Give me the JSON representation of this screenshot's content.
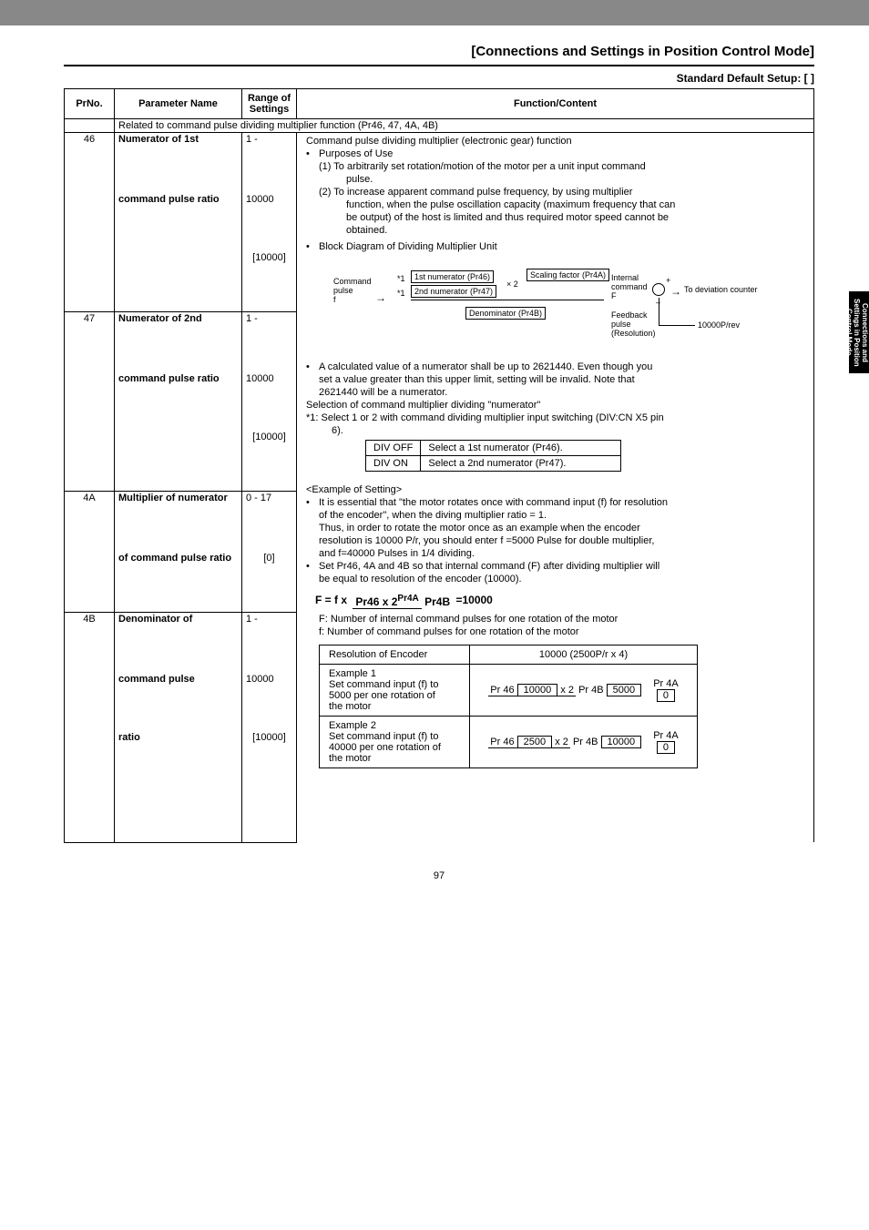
{
  "header": {
    "title": "[Connections and Settings in Position Control Mode]",
    "default_setup": "Standard Default Setup: [    ]"
  },
  "side_tab": "Connections and Settings in Position Control Mode",
  "page_number": "97",
  "columns": {
    "prno": "PrNo.",
    "name": "Parameter Name",
    "range": "Range of Settings",
    "func": "Function/Content"
  },
  "related_row": "Related to command pulse dividing multiplier function (Pr46, 47, 4A, 4B)",
  "rows": [
    {
      "prno": "46",
      "name_l1": "Numerator of 1st",
      "name_l2": "command pulse ratio",
      "range_l1": "1 -",
      "range_l2": "10000",
      "range_l3": "[10000]"
    },
    {
      "prno": "47",
      "name_l1": "Numerator of 2nd",
      "name_l2": "command pulse ratio",
      "range_l1": "1 -",
      "range_l2": "10000",
      "range_l3": "[10000]"
    },
    {
      "prno": "4A",
      "name_l1": "Multiplier of numerator",
      "name_l2": "of command pulse ratio",
      "range_l1": "0 - 17",
      "range_l3": "[0]"
    },
    {
      "prno": "4B",
      "name_l1": "Denominator of",
      "name_l2": "command pulse",
      "name_l3": "ratio",
      "range_l1": "1 -",
      "range_l2": "10000",
      "range_l3": "[10000]"
    }
  ],
  "fn": {
    "l1": "Command pulse dividing multiplier (electronic gear) function",
    "l2": "Purposes of Use",
    "l3": "(1) To arbitrarily set rotation/motion of the motor per a unit input command",
    "l3b": "pulse.",
    "l4": "(2) To increase apparent command pulse frequency, by using multiplier",
    "l4b": "function, when the pulse oscillation capacity (maximum frequency that can",
    "l4c": "be output) of the host is limited and thus required motor speed cannot be",
    "l4d": "obtained.",
    "l5": "Block Diagram of Dividing Multiplier Unit"
  },
  "diagram": {
    "cmd_pulse_l1": "Command",
    "cmd_pulse_l2": "pulse",
    "cmd_pulse_l3": "f",
    "star1": "*1",
    "num1": "1st numerator (Pr46)",
    "num2": "2nd numerator (Pr47)",
    "x2": "× 2",
    "scale": "Scaling factor (Pr4A)",
    "denom": "Denominator (Pr4B)",
    "internal_l1": "Internal",
    "internal_l2": "command",
    "internal_l3": "F",
    "sum_plus": "+",
    "sum_minus": "–",
    "to_dev": "To deviation counter",
    "fb_l1": "Feedback",
    "fb_l2": "pulse",
    "fb_l3": "(Resolution)",
    "res": "10000P/rev"
  },
  "calc": {
    "b1": "A calculated value of a numerator shall be up to 2621440.  Even though you",
    "b1b": "set a value greater than this upper limit, setting will be invalid.  Note that",
    "b1c": "2621440 will be a numerator.",
    "sel": "Selection of command multiplier dividing \"numerator\"",
    "star": "*1:  Select 1 or 2 with command dividing multiplier input switching (DIV:CN X5 pin",
    "starb": "6)."
  },
  "div_table": {
    "r1c1": "DIV OFF",
    "r1c2": "Select a 1st numerator (Pr46).",
    "r2c1": "DIV ON",
    "r2c2": "Select a 2nd numerator (Pr47)."
  },
  "example_heading": "<Example of Setting>",
  "ex": {
    "b1": "It is essential that \"the motor rotates once with command input (f) for resolution",
    "b1b": "of the encoder\", when the diving multiplier ratio = 1.",
    "b1c": "Thus, in order to rotate the motor once as an example when the encoder",
    "b1d": "resolution is 10000 P/r, you should enter f =5000 Pulse for double multiplier,",
    "b1e": "and f=40000 Pulses in 1/4 dividing.",
    "b2": "Set Pr46, 4A and 4B so that internal command (F) after dividing multiplier will",
    "b2b": "be equal to resolution of the encoder (10000)."
  },
  "formula": {
    "lhs": "F = f x",
    "num": "Pr46 x 2",
    "num_sup": "Pr4A",
    "den": "Pr4B",
    "rhs": "=10000",
    "fdesc": "F: Number of internal command pulses for one rotation of the motor",
    "fdesc2": "f: Number of command pulses for one rotation of the motor"
  },
  "extable": {
    "h1": "Resolution of Encoder",
    "h2": "10000 (2500P/r x 4)",
    "e1_l1": "Example 1",
    "e1_l2": "Set command input (f) to",
    "e1_l3": "5000 per one rotation of",
    "e1_l4": "the motor",
    "e1_pr4a": "Pr 4A",
    "e1_pr4a_v": "0",
    "e1_frac_top_pre": "Pr 46",
    "e1_frac_top_v": "10000",
    "e1_frac_top_post": "x 2",
    "e1_frac_bot_pre": "Pr 4B",
    "e1_frac_bot_v": "5000",
    "e2_l1": "Example 2",
    "e2_l2": "Set command input (f) to",
    "e2_l3": "40000 per one rotation of",
    "e2_l4": "the motor",
    "e2_pr4a": "Pr 4A",
    "e2_pr4a_v": "0",
    "e2_frac_top_v": "2500",
    "e2_frac_bot_v": "10000"
  }
}
